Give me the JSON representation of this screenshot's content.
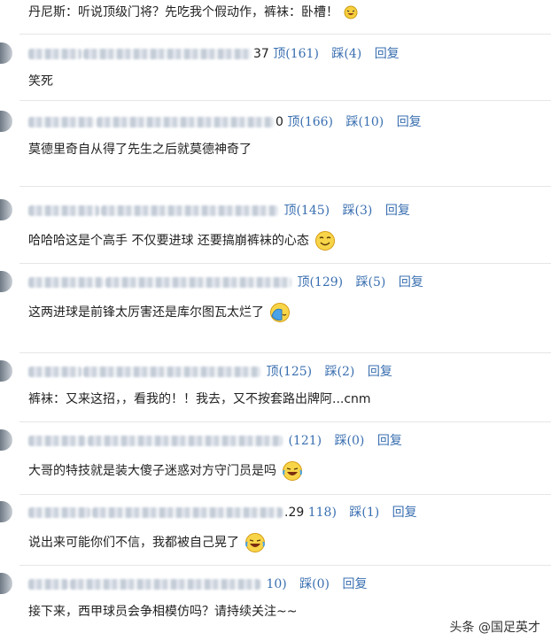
{
  "top_text": "丹尼斯：听说顶级门将？先吃我个假动作，裤袜：卧槽！",
  "comments": [
    {
      "meta_tail": "37",
      "up": "顶(161)",
      "down": "踩(4)",
      "reply": "回复",
      "text": "笑死",
      "emoji": ""
    },
    {
      "meta_tail": "0",
      "up": "顶(166)",
      "down": "踩(10)",
      "reply": "回复",
      "text": "莫德里奇自从得了先生之后就莫德神奇了",
      "emoji": ""
    },
    {
      "meta_tail": "",
      "up": "顶(145)",
      "down": "踩(3)",
      "reply": "回复",
      "text": "哈哈哈这是个高手 不仅要进球 还要搞崩裤袜的心态",
      "emoji": "wink-smile-icon"
    },
    {
      "meta_tail": "",
      "up": "顶(129)",
      "down": "踩(5)",
      "reply": "回复",
      "text": "这两进球是前锋太厉害还是库尔图瓦太烂了",
      "emoji": "face-palm-icon"
    },
    {
      "meta_tail": "",
      "up": "顶(125)",
      "down": "踩(2)",
      "reply": "回复",
      "text": "裤袜：又来这招，，看我的！！我去，又不按套路出牌阿...cnm",
      "emoji": ""
    },
    {
      "meta_tail": "",
      "up": "(121)",
      "down": "踩(0)",
      "reply": "回复",
      "text": "大哥的特技就是装大傻子迷惑对方守门员是吗",
      "emoji": "laughing-tears-icon"
    },
    {
      "meta_tail": ".29",
      "up": "118)",
      "down": "踩(1)",
      "reply": "回复",
      "text": "说出来可能你们不信，我都被自己晃了",
      "emoji": "laughing-tears-icon"
    },
    {
      "meta_tail": "",
      "up": "10)",
      "down": "踩(0)",
      "reply": "回复",
      "text": "接下来，西甲球员会争相模仿吗？请持续关注~~",
      "emoji": ""
    }
  ],
  "watermark": "头条 @国足英才"
}
